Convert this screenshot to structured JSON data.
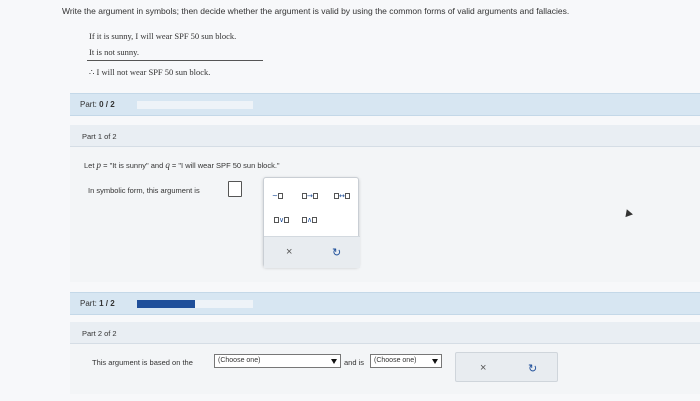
{
  "question": {
    "prompt": "Write the argument in symbols; then decide whether the argument is valid by using the common forms of valid arguments and fallacies.",
    "premise1": "If it is sunny, I will wear SPF 50 sun block.",
    "premise2": "It is not sunny.",
    "conclusion": "∴ I will not wear SPF 50 sun block."
  },
  "part_bar_top": {
    "label_prefix": "Part: ",
    "label_value": "0 / 2",
    "progress": 0.0
  },
  "part1": {
    "header": "Part 1 of 2",
    "let_prefix": "Let ",
    "p_var": "p",
    "p_def": " = \"It is sunny\" and ",
    "q_var": "q",
    "q_def": " = \"I will wear SPF 50 sun block.\"",
    "symbolic_prompt": "In symbolic form, this argument is",
    "keypad": {
      "neg": "~",
      "cond": "→",
      "bicond": "↔",
      "or": "∨",
      "and": "∧",
      "clear": "×",
      "undo": "↻"
    }
  },
  "part_bar_bottom": {
    "label_prefix": "Part: ",
    "label_value": "1 / 2",
    "progress": 0.5
  },
  "part2": {
    "header": "Part 2 of 2",
    "text_before": "This argument is based on the",
    "select1": "(Choose one)",
    "text_mid": "and is",
    "select2": "(Choose one)",
    "clear": "×",
    "undo": "↻"
  },
  "colors": {
    "accent": "#1f4f9a",
    "bar": "#d7e6f2"
  }
}
